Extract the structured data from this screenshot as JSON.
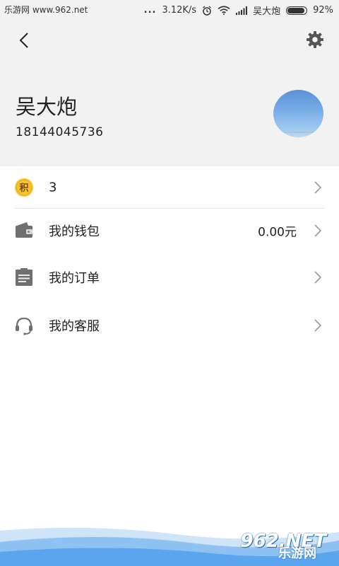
{
  "status_bar": {
    "watermark_left": "乐游网 www.962.net",
    "dots": "...",
    "speed": "3.12K/s",
    "carrier": "吴大炮",
    "battery": "92%",
    "battery_level": 0.92
  },
  "header": {
    "user_name": "吴大炮",
    "phone": "18144045736"
  },
  "menu": {
    "points": {
      "badge": "积",
      "value": "3"
    },
    "wallet": {
      "label": "我的钱包",
      "value": "0.00元"
    },
    "orders": {
      "label": "我的订单"
    },
    "service": {
      "label": "我的客服"
    }
  },
  "footer": {
    "watermark_top": "962.NET",
    "watermark_bottom": "乐游网"
  },
  "colors": {
    "header_bg": "#f2f2f2",
    "icon_gray": "#6f6f6f",
    "points_gold": "#f7c533",
    "wave_blue": "#5aa5ee"
  }
}
